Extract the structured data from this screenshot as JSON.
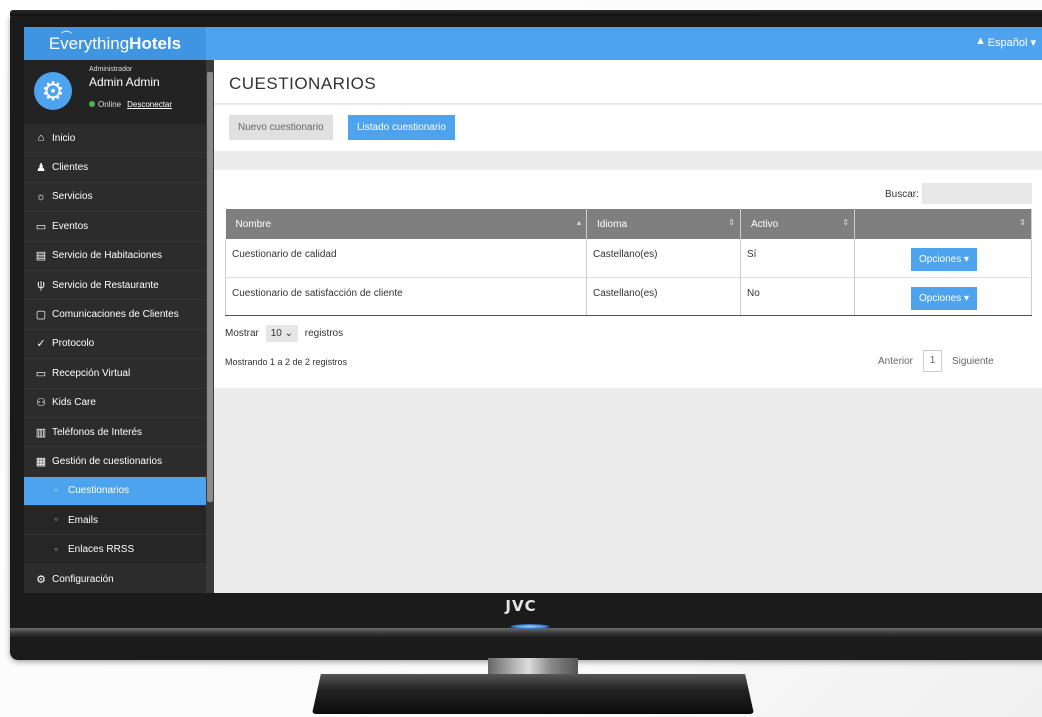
{
  "brand": {
    "logo_part1": "Everything",
    "logo_part2": "Hotels",
    "tv_brand": "JVC"
  },
  "topbar": {
    "language": "Español ▾"
  },
  "user": {
    "role": "Administrador",
    "name": "Admin Admin",
    "status": "Online",
    "disconnect": "Desconectar"
  },
  "sidebar": {
    "items": [
      {
        "label": "Inicio",
        "icon": "home-icon",
        "glyph": "⌂"
      },
      {
        "label": "Clientes",
        "icon": "users-icon",
        "glyph": "♟"
      },
      {
        "label": "Servicios",
        "icon": "sun-icon",
        "glyph": "☼"
      },
      {
        "label": "Eventos",
        "icon": "calendar-icon",
        "glyph": "▭"
      },
      {
        "label": "Servicio de Habitaciones",
        "icon": "bed-icon",
        "glyph": "▤"
      },
      {
        "label": "Servicio de Restaurante",
        "icon": "cutlery-icon",
        "glyph": "ψ"
      },
      {
        "label": "Comunicaciones de Clientes",
        "icon": "chat-icon",
        "glyph": "▢"
      },
      {
        "label": "Protocolo",
        "icon": "shield-check-icon",
        "glyph": "✓"
      },
      {
        "label": "Recepción Virtual",
        "icon": "video-icon",
        "glyph": "▭"
      },
      {
        "label": "Kids Care",
        "icon": "kids-icon",
        "glyph": "⚇"
      },
      {
        "label": "Teléfonos de Interés",
        "icon": "phonebook-icon",
        "glyph": "▥"
      },
      {
        "label": "Gestión de cuestionarios",
        "icon": "form-icon",
        "glyph": "▦"
      },
      {
        "label": "Cuestionarios",
        "icon": "bullet-icon",
        "glyph": "○",
        "sub": true,
        "active": true
      },
      {
        "label": "Emails",
        "icon": "bullet-icon",
        "glyph": "○",
        "sub": true
      },
      {
        "label": "Enlaces RRSS",
        "icon": "bullet-icon",
        "glyph": "○",
        "sub": true
      },
      {
        "label": "Configuración",
        "icon": "gear-icon",
        "glyph": "⚙"
      }
    ]
  },
  "page": {
    "title": "CUESTIONARIOS",
    "tab_new": "Nuevo cuestionario",
    "tab_list": "Listado cuestionario",
    "search_label": "Buscar:",
    "search_value": ""
  },
  "table": {
    "headers": [
      "Nombre",
      "Idioma",
      "Activo",
      ""
    ],
    "rows": [
      {
        "name": "Cuestionario de calidad",
        "lang": "Castellano(es)",
        "active": "Sí",
        "action": "Opciones ▾"
      },
      {
        "name": "Cuestionario de satisfacción de cliente",
        "lang": "Castellano(es)",
        "active": "No",
        "action": "Opciones ▾"
      }
    ]
  },
  "footer": {
    "show_prefix": "Mostrar",
    "show_value": "10",
    "show_suffix": "registros",
    "info": "Mostrando 1 a 2 de 2 registros",
    "prev": "Anterior",
    "page": "1",
    "next": "Siguiente"
  }
}
